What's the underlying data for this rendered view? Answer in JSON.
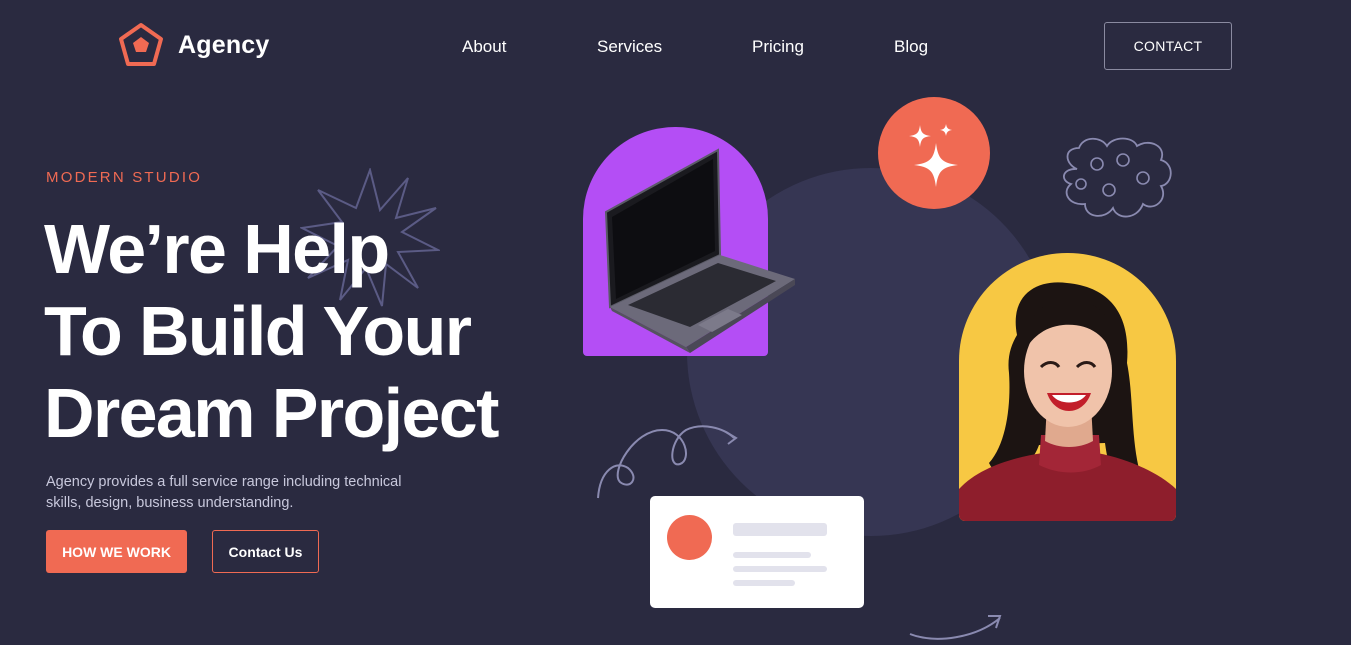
{
  "brand": {
    "name": "Agency"
  },
  "nav": {
    "items": [
      "About",
      "Services",
      "Pricing",
      "Blog"
    ],
    "contact_label": "CONTACT"
  },
  "hero": {
    "eyebrow": "MODERN STUDIO",
    "title_lines": [
      "We’re Help",
      "To Build Your",
      "Dream Project"
    ],
    "description_lines": [
      "Agency provides a full service range including technical",
      "skills, design, business understanding."
    ],
    "primary_button": "HOW WE WORK",
    "secondary_button": "Contact Us"
  },
  "colors": {
    "background": "#2a2a40",
    "accent": "#f06a53",
    "purple": "#b44ef5",
    "yellow": "#f7c843",
    "circle": "#363653"
  },
  "icons": [
    "pentagon-logo-icon",
    "sparkle-icon",
    "starburst-doodle",
    "cloud-doodle",
    "squiggle-doodle",
    "arrow-doodle"
  ]
}
